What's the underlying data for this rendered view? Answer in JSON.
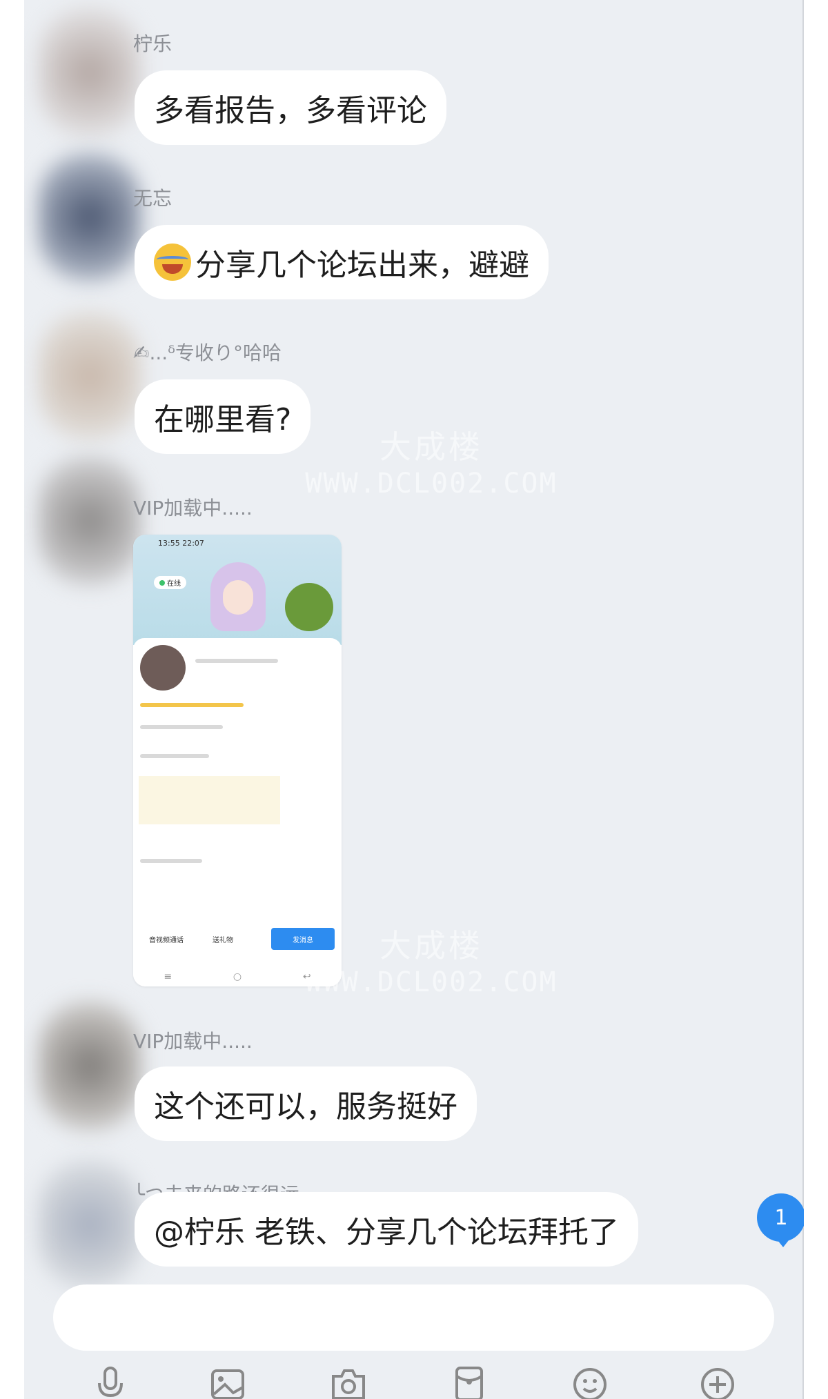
{
  "messages": [
    {
      "name": "柠乐",
      "text": "多看报告，多看评论"
    },
    {
      "name": "无忘",
      "text": "分享几个论坛出来，避避"
    },
    {
      "name": "✍...ᵟ专收り°哈哈",
      "text": "在哪里看?"
    },
    {
      "name": "VIP加载中.....",
      "image": "app-profile-screenshot"
    },
    {
      "name": "VIP加载中.....",
      "text": "这个还可以，服务挺好"
    },
    {
      "name": "╰つ未来的路还很远╮╮",
      "text": "@柠乐 老铁、分享几个论坛拜托了"
    }
  ],
  "watermark": {
    "line1": "大成楼",
    "line2": "WWW.DCL002.COM"
  },
  "unread_badge": "1",
  "screenshot": {
    "status_time": "13:55 22:07",
    "online_label": "在线",
    "buttons": [
      "音视频通话",
      "送礼物",
      "发消息"
    ]
  },
  "toolbar": [
    "microphone-icon",
    "image-icon",
    "camera-icon",
    "red-packet-icon",
    "emoji-icon",
    "plus-icon"
  ],
  "colors": {
    "background": "#eceff3",
    "bubble": "#ffffff",
    "badge": "#2d8cf0"
  }
}
